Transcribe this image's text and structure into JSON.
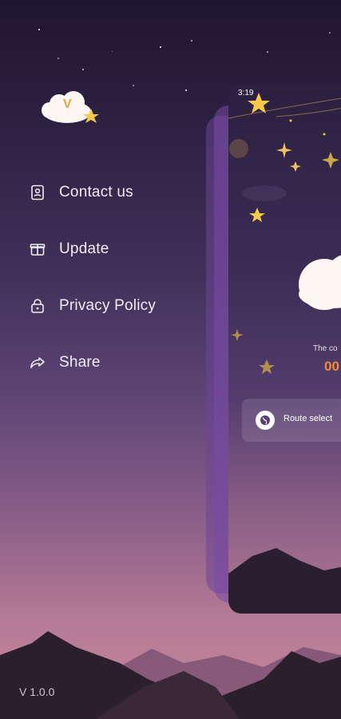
{
  "phone_preview": {
    "status_time": "3:19",
    "connection_label": "The co",
    "connection_timer": "00",
    "route_label": "Route select"
  },
  "menu": {
    "items": [
      {
        "label": "Contact us",
        "icon": "contact-card-icon"
      },
      {
        "label": "Update",
        "icon": "gift-box-icon"
      },
      {
        "label": "Privacy Policy",
        "icon": "lock-icon"
      },
      {
        "label": "Share",
        "icon": "share-arrow-icon"
      }
    ]
  },
  "footer": {
    "version": "V 1.0.0"
  },
  "logo": {
    "letter": "V",
    "icon": "cloud-star-logo"
  },
  "colors": {
    "accent_orange": "#f28b3a",
    "star_yellow": "#f6c94a"
  }
}
